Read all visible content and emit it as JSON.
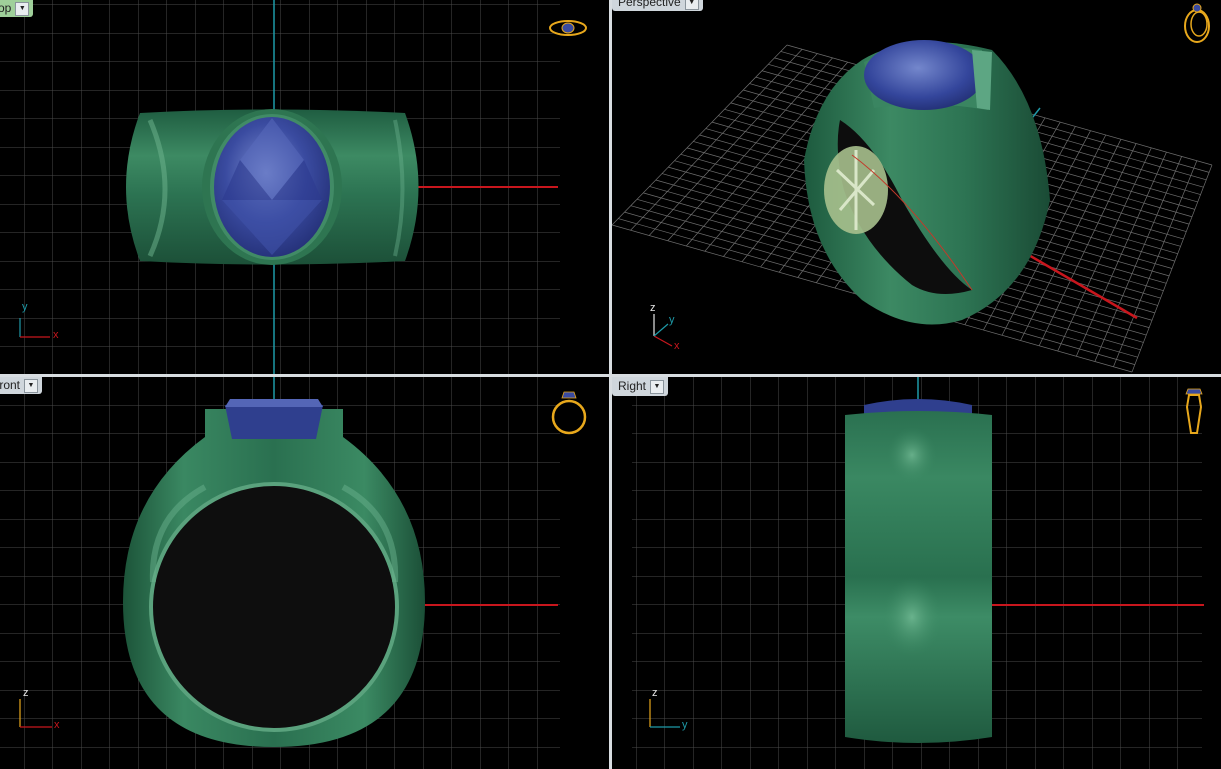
{
  "viewports": {
    "top": {
      "label": "Top",
      "axis_h": "x",
      "axis_v": "y"
    },
    "perspective": {
      "label": "Perspective",
      "axis_h": "x",
      "axis_v": "y",
      "axis_z": "z"
    },
    "front": {
      "label": "Front",
      "axis_h": "x",
      "axis_v": "z"
    },
    "right": {
      "label": "Right",
      "axis_h": "y",
      "axis_v": "z"
    }
  },
  "colors": {
    "metal": "#2f7a57",
    "metal_highlight": "#5fa985",
    "gem": "#2f3f8e",
    "gem_highlight": "#6a7cc4",
    "grid": "#4a4a4a",
    "x_axis": "#c8161d",
    "y_axis": "#1e9aa8",
    "gizmo": "#e8a81c"
  },
  "icons": [
    "ring-top-view-icon",
    "ring-perspective-icon",
    "ring-front-view-icon",
    "ring-side-view-icon",
    "dropdown-arrow-icon"
  ]
}
